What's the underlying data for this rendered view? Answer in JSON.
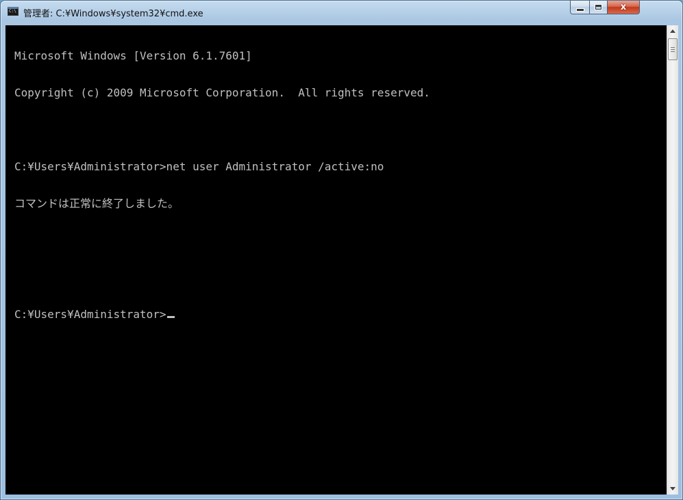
{
  "window": {
    "icon_label": "C:\\",
    "title": "管理者: C:¥Windows¥system32¥cmd.exe",
    "controls": {
      "minimize": "minimize",
      "maximize": "maximize",
      "close": "x"
    }
  },
  "console": {
    "lines": [
      "Microsoft Windows [Version 6.1.7601]",
      "Copyright (c) 2009 Microsoft Corporation.  All rights reserved.",
      "",
      "C:¥Users¥Administrator>net user Administrator /active:no",
      "コマンドは正常に終了しました。",
      "",
      "",
      "C:¥Users¥Administrator>"
    ]
  },
  "colors": {
    "console_bg": "#000000",
    "console_fg": "#c0c0c0",
    "close_button": "#c7412a",
    "frame": "#9dbfe0"
  }
}
